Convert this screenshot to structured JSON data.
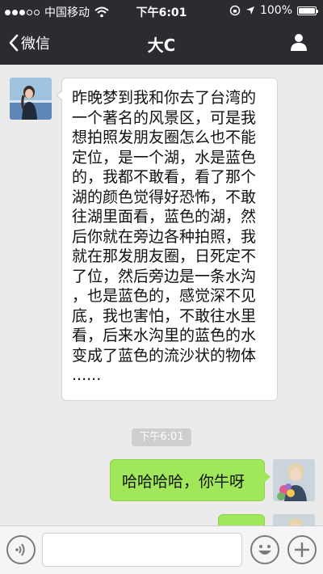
{
  "status_bar": {
    "carrier": "中国移动",
    "time": "下午6:01",
    "battery": "100%",
    "battery_level": 1.0
  },
  "nav": {
    "back_label": "微信",
    "title": "大C"
  },
  "messages": [
    {
      "side": "left",
      "text_lines": [
        "昨晚梦到我和你去了台湾的",
        "一个著名的风景区，可是我",
        "想拍照发朋友圈怎么也不能",
        "定位，是一个湖，水是蓝色",
        "的，我都不敢看，看了那个",
        "湖的颜色觉得好恐怖，不敢",
        "往湖里面看，蓝色的湖，然",
        "后你就在旁边各种拍照，我",
        "就在那发朋友圈，日死定不",
        "了位，然后旁边是一条水沟",
        "，也是蓝色的，感觉深不见",
        "底，我也害怕，不敢往水里",
        "看，后来水沟里的蓝色的水",
        "变成了蓝色的流沙状的物体",
        "......"
      ]
    },
    {
      "side": "right",
      "text": "哈哈哈哈，你牛呀"
    }
  ],
  "timestamp": "下午6:01",
  "colors": {
    "nav_bg": "#2b2b30",
    "chat_bg": "#ebebeb",
    "bubble_green": "#a0e75a",
    "bubble_white": "#ffffff"
  },
  "icons": {
    "back": "chevron-left-icon",
    "profile": "person-icon",
    "voice": "voice-icon",
    "emoji": "emoji-icon",
    "plus": "plus-icon"
  }
}
